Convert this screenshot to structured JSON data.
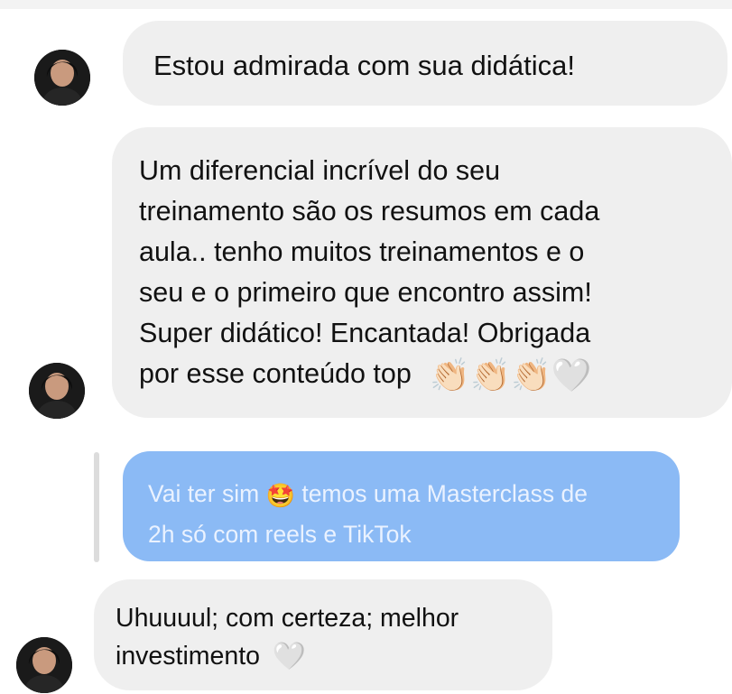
{
  "messages": [
    {
      "from": "contact",
      "text": "Estou admirada com sua didática!"
    },
    {
      "from": "contact",
      "lines": [
        "Um diferencial incrível do seu",
        "treinamento são os resumos em cada",
        "aula.. tenho muitos treinamentos e o",
        "seu e o primeiro que encontro assim!",
        "Super didático! Encantada! Obrigada"
      ],
      "last_line": "por esse conteúdo top",
      "emojis": [
        "👏🏻",
        "👏🏻",
        "👏🏻",
        "🤍"
      ]
    },
    {
      "from": "me",
      "line1_before": "Vai ter sim",
      "line1_emoji": "🤩",
      "line1_after": "temos uma Masterclass de",
      "line2": "2h só com reels e TikTok"
    },
    {
      "from": "contact",
      "line1": "Uhuuuul; com certeza; melhor",
      "line2": "investimento",
      "emoji": "🤍"
    }
  ],
  "colors": {
    "incoming_bubble": "#efefef",
    "outgoing_bubble": "#8bbaf5",
    "outgoing_text": "#eaf2ff"
  }
}
